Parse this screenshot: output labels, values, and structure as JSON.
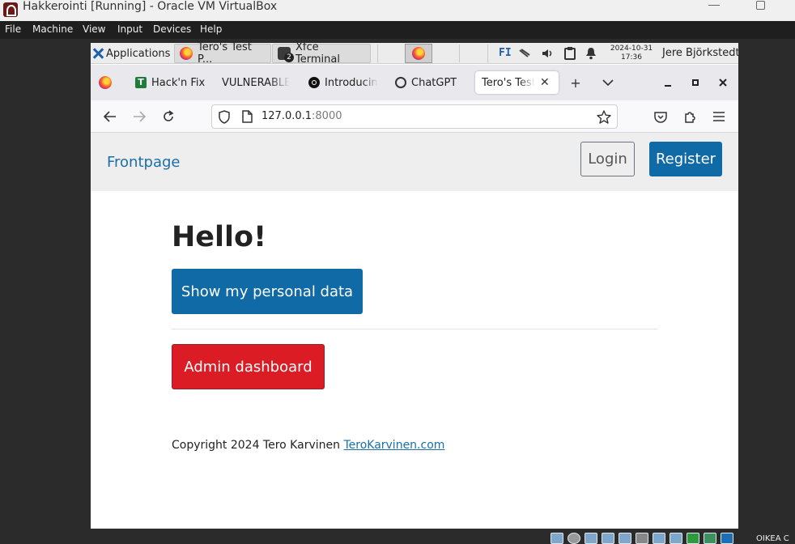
{
  "host": {
    "title": "Hakkerointi [Running] - Oracle VM VirtualBox",
    "menu": [
      "File",
      "Machine",
      "View",
      "Input",
      "Devices",
      "Help"
    ],
    "tray_label": "OIKEA C"
  },
  "xfce": {
    "applications": "Applications",
    "tasks": [
      {
        "label": "Tero's Test P...",
        "icon": "firefox-icon"
      },
      {
        "label": "Xfce Terminal",
        "icon": "terminal-icon",
        "badge": "2"
      }
    ],
    "keyboard_layout": "FI",
    "clock_date": "2024-10-31",
    "clock_time": "17:36",
    "user": "Jere Björkstedt"
  },
  "browser": {
    "tabs": [
      {
        "label": "Hack'n Fix",
        "icon": "tab-t-icon"
      },
      {
        "label": "VULNERABLE",
        "icon": "none"
      },
      {
        "label": "Introducin",
        "icon": "circle-icon"
      },
      {
        "label": "ChatGPT",
        "icon": "chatgpt-icon"
      },
      {
        "label": "Tero's Test I",
        "icon": "none",
        "active": true
      }
    ],
    "url_host": "127.0.0.1",
    "url_port": ":8000"
  },
  "site": {
    "brand": "Frontpage",
    "login_label": "Login",
    "register_label": "Register",
    "heading": "Hello!",
    "personal_data_label": "Show my personal data",
    "admin_label": "Admin dashboard",
    "footer_text": "Copyright 2024 Tero Karvinen ",
    "footer_link": "TeroKarvinen.com"
  },
  "colors": {
    "primary": "#0f6aa6",
    "danger": "#dc1c24",
    "link": "#1a6fa8"
  }
}
